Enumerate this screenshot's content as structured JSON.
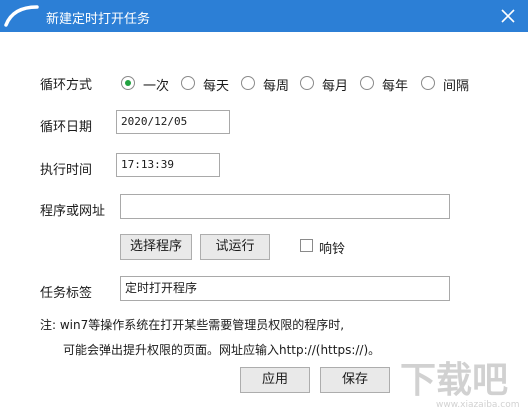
{
  "window": {
    "title": "新建定时打开任务",
    "close_icon": "close-icon",
    "accent": "#2c7fd6"
  },
  "form": {
    "mode_label": "循环方式",
    "modes": [
      {
        "label": "一次",
        "selected": true
      },
      {
        "label": "每天",
        "selected": false
      },
      {
        "label": "每周",
        "selected": false
      },
      {
        "label": "每月",
        "selected": false
      },
      {
        "label": "每年",
        "selected": false
      },
      {
        "label": "间隔",
        "selected": false
      }
    ],
    "date_label": "循环日期",
    "date_value": "2020/12/05",
    "time_label": "执行时间",
    "time_value": "17:13:39",
    "program_label": "程序或网址",
    "program_value": "",
    "choose_program": "选择程序",
    "trial_run": "试运行",
    "ring_label": "响铃",
    "ring_checked": false,
    "task_label_label": "任务标签",
    "task_label_value": "定时打开程序"
  },
  "note": {
    "line1": "注: win7等操作系统在打开某些需要管理员权限的程序时,",
    "line2": "可能会弹出提升权限的页面。网址应输入http://(https://)。"
  },
  "buttons": {
    "apply": "应用",
    "save": "保存"
  },
  "watermark": {
    "text": "下载吧",
    "url": "www.xiazaiba.com"
  },
  "colors": {
    "selected_radio": "#22a241"
  }
}
